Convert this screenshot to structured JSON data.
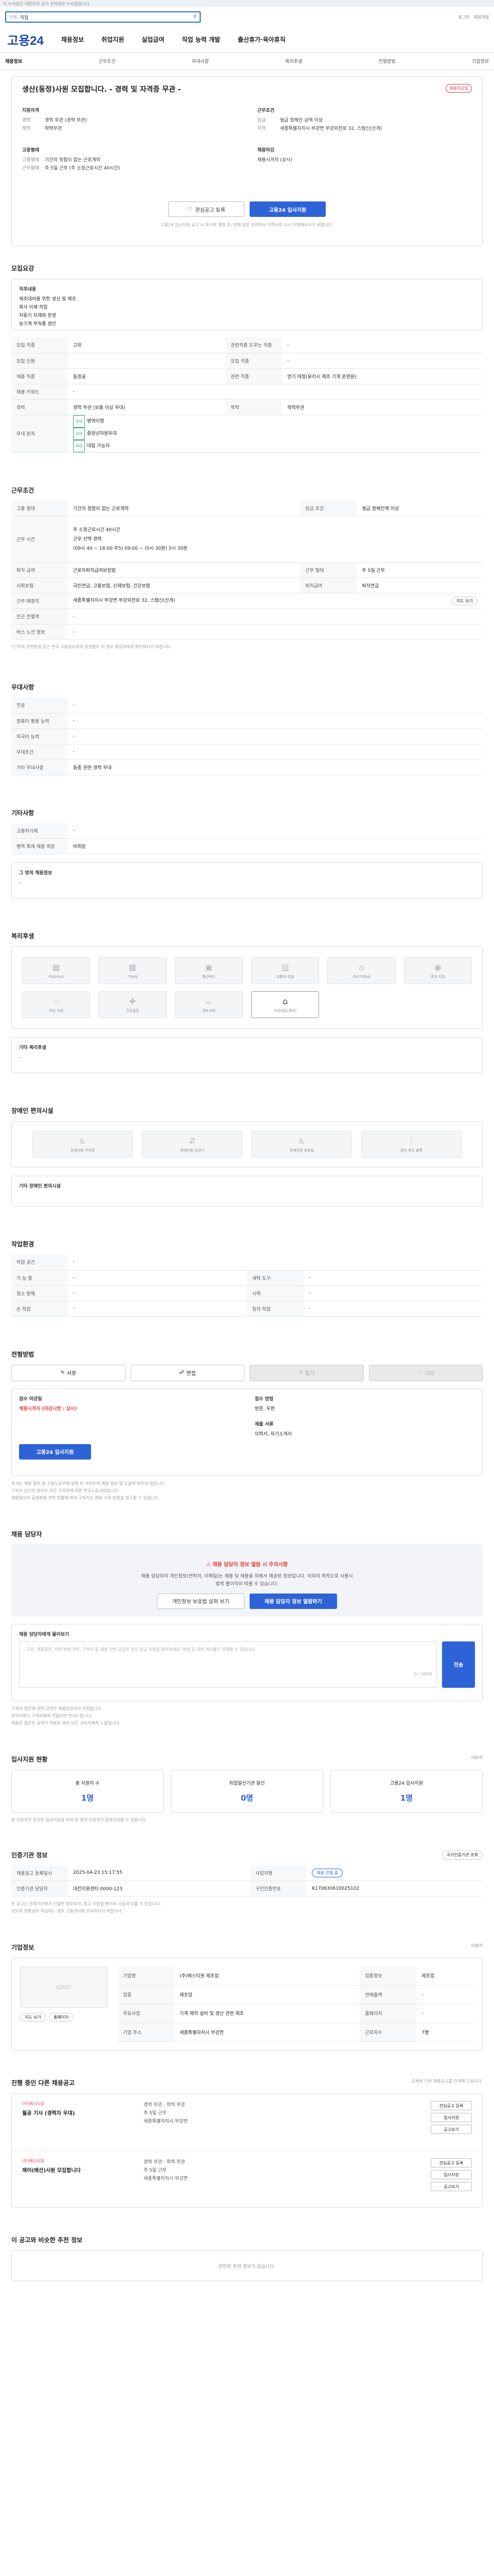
{
  "topbar": {
    "text": "이 누리집은 대한민국 공식 전자정부 누리집입니다."
  },
  "search": {
    "select": "전체",
    "value": "직업",
    "util_login": "로그인",
    "util_join": "회원가입"
  },
  "gnb": {
    "logo": "고용24",
    "items": [
      "채용정보",
      "취업지원",
      "실업급여",
      "직업 능력 개발",
      "출산휴가·육아휴직"
    ]
  },
  "subnav": {
    "items": [
      "채용정보",
      "근무조건",
      "우대사항",
      "복리후생",
      "전형방법",
      "기업정보"
    ]
  },
  "header": {
    "title": "생산(동정)사원 모집합니다. - 경력 및 자격증 무관 -",
    "badge": "채용마감일",
    "applicant_h": "지원자격",
    "applicant": [
      {
        "k": "경력",
        "v": "경력 무관 (경력 무관)"
      },
      {
        "k": "학력",
        "v": "학력무관"
      }
    ],
    "conditions_h": "근무조건",
    "conditions": [
      {
        "k": "임금",
        "v": "월급 정해진 금액 이상"
      },
      {
        "k": "지역",
        "v": "세종특별자치시 부강면 부강외천로 32, 스템신(산개)"
      }
    ],
    "type_h": "고용형태",
    "type": [
      {
        "k": "고용형태",
        "v": "기간의 정함이 없는 근로계약"
      },
      {
        "k": "근무형태",
        "v": "주 5일 근무 (주 소정근로시간 40시간)"
      }
    ],
    "deadline_h": "채용마감",
    "deadline": [
      {
        "k": "",
        "v": "채용시까지 (상시)"
      }
    ],
    "btn_interest": "관심공고 등록",
    "btn_apply": "고용24 입사지원",
    "notice": "고용24 입사지원 공고 시 회사의 결정 후, 전화 방문 지원하시 이력서로 다시 지원해보시기 바랍니다."
  },
  "recruit": {
    "title": "모집요강",
    "duty_h": "직무내용",
    "duty": [
      "제조대비를 위한 생산 및 제조",
      "회사 이제 작업",
      "자동기 자재와 운영",
      "농기계 부속품 생산"
    ],
    "rows": [
      {
        "k": "모집 직종",
        "v": "고위",
        "k2": "관련직종 도우는 직종",
        "v2": "-"
      },
      {
        "k": "모집 인원",
        "v": "",
        "k2": "모집 직종",
        "v2": "-"
      },
      {
        "k": "채용 직종",
        "v": "동정공",
        "k2": "관련 직종",
        "v2": "연기 테정(유리시 제조 기계 운영원)"
      },
      {
        "k": "채용 키워드",
        "v": "-",
        "k2": "",
        "v2": ""
      },
      {
        "k": "경력",
        "v": "경력 무관 (보통 이상 우대)",
        "k2": "학력",
        "v2": "학력무관"
      }
    ],
    "pref_label": "우대 원칙",
    "pref": [
      {
        "tag": "우대",
        "v": "병역이행"
      },
      {
        "tag": "우대",
        "v": "중장년자원우대"
      },
      {
        "tag": "우대",
        "v": "대립 가능자"
      }
    ]
  },
  "work": {
    "title": "근무조건",
    "rows": [
      {
        "k": "고용 형태",
        "v": "기간의 정함이 없는 근로계약",
        "k2": "임금 조건",
        "v2": "월급 정해진액 이상"
      },
      {
        "k": "근무 시간",
        "v": "주 소정근로시간 40시간",
        "k2": "",
        "v2": ""
      },
      {
        "k": "근무 시간",
        "v": "(08:00~17:00) 주5 ~ (11:00) 5시 30분",
        "k2": "",
        "v2": ""
      },
      {
        "k": "퇴직 급여",
        "v": "근로자퇴직급여보장법",
        "k2": "근무 형태",
        "v2": "주 5일 근무"
      },
      {
        "k": "사회보험",
        "v": "국민연금, 고용보험, 산재보험, 건강보험",
        "k2": "퇴직급여",
        "v2": "퇴직연금"
      },
      {
        "k": "근무 예정지",
        "v": "세종특별자치시 부강면 부강외천로 32, 스템신(산개)",
        "k2": "",
        "v2": ""
      },
      {
        "k": "인근 전철역",
        "v": "-",
        "k2": "",
        "v2": ""
      },
      {
        "k": "버스 노선 정보",
        "v": "-",
        "k2": "",
        "v2": ""
      }
    ],
    "hours_label": "근무 시간",
    "hours_detail": [
      "근무 선택 경력",
      "(09시 40 ~ 18:00 주5) 09:00 ~ (5시 30분) 5시 30분"
    ],
    "map_btn": "지도 보기",
    "note": "*근무지 주변환경 등은 한국 고용정보원과 상관없이 이 정보 제공자에게 확인하시기 바랍니다."
  },
  "prefer": {
    "title": "우대사항",
    "rows": [
      {
        "k": "전공",
        "v": "-"
      },
      {
        "k": "컴퓨터 활용 능력",
        "v": "-"
      },
      {
        "k": "외국어 능력",
        "v": "-"
      },
      {
        "k": "우대조건",
        "v": "-"
      },
      {
        "k": "기타 우대사항",
        "v": "동종 관련 경력 우대"
      }
    ]
  },
  "etc": {
    "title": "기타사항",
    "rows": [
      {
        "k": "고용허가제",
        "v": "-"
      },
      {
        "k": "병역 특례 채용 희망",
        "v": "비희망"
      }
    ],
    "other_h": "그 밖의 채용정보",
    "other_v": "-"
  },
  "welfare": {
    "title": "복리후생",
    "items": [
      {
        "icon": "food-icon",
        "label": "식당(숙소)",
        "on": false
      },
      {
        "icon": "bus-icon",
        "label": "기숙사",
        "on": false
      },
      {
        "icon": "car-icon",
        "label": "통근버스",
        "on": false
      },
      {
        "icon": "gift-icon",
        "label": "교통비 지원",
        "on": false
      },
      {
        "icon": "house-icon",
        "label": "자녀 학자금",
        "on": false
      },
      {
        "icon": "money-icon",
        "label": "주거 지원",
        "on": false
      },
      {
        "icon": "medal-icon",
        "label": "연금 지원",
        "on": false
      },
      {
        "icon": "health-icon",
        "label": "건강검진",
        "on": false
      },
      {
        "icon": "cup-icon",
        "label": "경조사비",
        "on": false
      },
      {
        "icon": "home-icon",
        "label": "사내대출(제지)",
        "on": true
      }
    ],
    "other_h": "기타 복리후생",
    "other_v": "-"
  },
  "disabled": {
    "title": "장애인 편의시설",
    "items": [
      "장애인용 주차장",
      "장애인용 승강기",
      "장애인용 화장실",
      "점자 유도 블록"
    ],
    "other": "기타 장애인 편의시설"
  },
  "location": {
    "title": "작업환경",
    "rows": [
      {
        "k": "작업 공간",
        "v": "-",
        "k2": "",
        "v2": ""
      },
      {
        "k": "기 능 할",
        "v": "-",
        "k2": "세탁 도구",
        "v2": "-"
      },
      {
        "k": "청소 방해",
        "v": "-",
        "k2": "시력",
        "v2": "-"
      },
      {
        "k": "손 작업",
        "v": "-",
        "k2": "청각 작업",
        "v2": "-"
      }
    ]
  },
  "selection": {
    "title": "전형방법",
    "tabs": [
      {
        "label": "서류",
        "on": true
      },
      {
        "label": "면접",
        "on": true
      },
      {
        "label": "필기",
        "on": false
      },
      {
        "label": "기타",
        "on": false
      }
    ],
    "apply_h": "접수 마감일",
    "apply_v": "채용시까지 (마감시한 : 상시)",
    "method_h": "접수 방법",
    "method_v": "방문, 우편",
    "docs_h": "제출 서류",
    "docs_v": "이력서, 자기소개서",
    "apply_btn": "고용24 입사지원",
    "notes": [
      "본사는 채용 절차 및 고용노동부에 맞춰 본 사이트의 채용 정보 및 도움에 따르지 않습니다.",
      "구직자 당신의 정보로 모든 구직자에 대한 한국노동사법입니다.",
      "채용절차의 공정화에 관한 법률에 따라 구직자는 채용 서류 반환을 청구할 수 있습니다."
    ]
  },
  "contact": {
    "title": "채용 담당자",
    "alert": "채용 담당자 정보 열람 시 주의사항",
    "alert_body": "채용 담당자의 개인정보(연락처, 이메일)는 채용 및 채용을 위해서 제공된 정보입니다. 이외의 목적으로 사용시 법적 불이익이 따를 수 있습니다.",
    "btn_check": "개인정보 보호법 살펴 보기",
    "btn_view": "채용 담당자 정보 열람하기",
    "q_title": "채용 담당자에게 물어보기",
    "q_placeholder": "- 근로, 채용절차, 전형 방법 관련, 구직자 등 채용 관련 궁금한 점은 궁금 사항을 물어보세요. 욕설 등 위반 게시물은 삭제될 수 있습니다.",
    "q_count": "0 / 500자",
    "q_btn": "전송",
    "q_notes": [
      "구직자 질문에 대한 답변은 채용담당자가 직접합니다.",
      "문의사항이 구직자에게 전달되면 안내드립니다.",
      "채용된 질문은 공개가 허용된 경우 모든 구직자에게 노출됩니다."
    ]
  },
  "stats": {
    "title": "입사지원 현황",
    "more": "더보기",
    "items": [
      {
        "label": "총 지원자 수",
        "v": "1명"
      },
      {
        "label": "취업알선기관 알선",
        "v": "0명"
      },
      {
        "label": "고용24 입사지원",
        "v": "1명"
      }
    ],
    "note": "본 지원자가 온라인 입사지원을 하여 한 명의 지원자가 중복지원할 수 있습니다."
  },
  "org": {
    "title": "인증기관 정보",
    "cert_btn": "국가인증기관 조회",
    "rows": [
      {
        "k": "채용공고 등록일시",
        "v": "2025-04-23 15:17:55",
        "k2": "사업자명",
        "v2": "",
        "badge": "채용 진행 중"
      },
      {
        "k": "인증기관 담당자",
        "v": "대전지원센터 0000-123",
        "k2": "구인인증번호",
        "v2": "K170630610025102"
      }
    ],
    "notes": [
      "본 공고는 관계기관에서 인증한 정보로서, 참고 사항일 뿐이며 사실과 다를 수 있습니다.",
      "정보의 정확성이 의심되는 경우 고용센터에 문의하시기 바랍니다."
    ]
  },
  "company": {
    "title": "기업정보",
    "more": "더보기",
    "logo": "LOGO",
    "btn_map": "지도 보기",
    "btn_homepage": "홈페이지",
    "rows": [
      {
        "k": "기업명",
        "v": "(주)에스티원 제조업",
        "k2": "업종정보",
        "v2": "제조업"
      },
      {
        "k": "업종",
        "v": "제조업",
        "k2": "연매출액",
        "v2": "-"
      },
      {
        "k": "주요사업",
        "v": "기계 제작 설비 및 생산 관련 제조",
        "k2": "홈페이지",
        "v2": "-"
      },
      {
        "k": "기업 주소",
        "v": "세종특별자치시 부강면",
        "k2": "근로자수",
        "v2": "7명"
      }
    ]
  },
  "more_jobs": {
    "title": "진행 중인 다른 채용공고",
    "note": "등록된 다른 채용공고를 안내해 드립니다.",
    "items": [
      {
        "company": "(주)에스티원",
        "title": "월공 기사 (경력자 우대)",
        "lines": [
          "경력 무관 · 학력 무관",
          "주 5일 근무",
          "세종특별자치시 부강면"
        ],
        "btn1": "관심공고 등록",
        "btn2": "입사지원",
        "btn3": "공고보기"
      },
      {
        "company": "(주)에스티원",
        "title": "제어(배선)사원 모집합니다",
        "lines": [
          "경력 무관 · 학력 무관",
          "주 5일 근무",
          "세종특별자치시 부강면"
        ],
        "btn1": "관심공고 등록",
        "btn2": "입사지원",
        "btn3": "공고보기"
      }
    ]
  },
  "recommend": {
    "title": "이 공고와 비슷한 추천 정보",
    "empty": "관련된 추천 정보가 없습니다."
  }
}
